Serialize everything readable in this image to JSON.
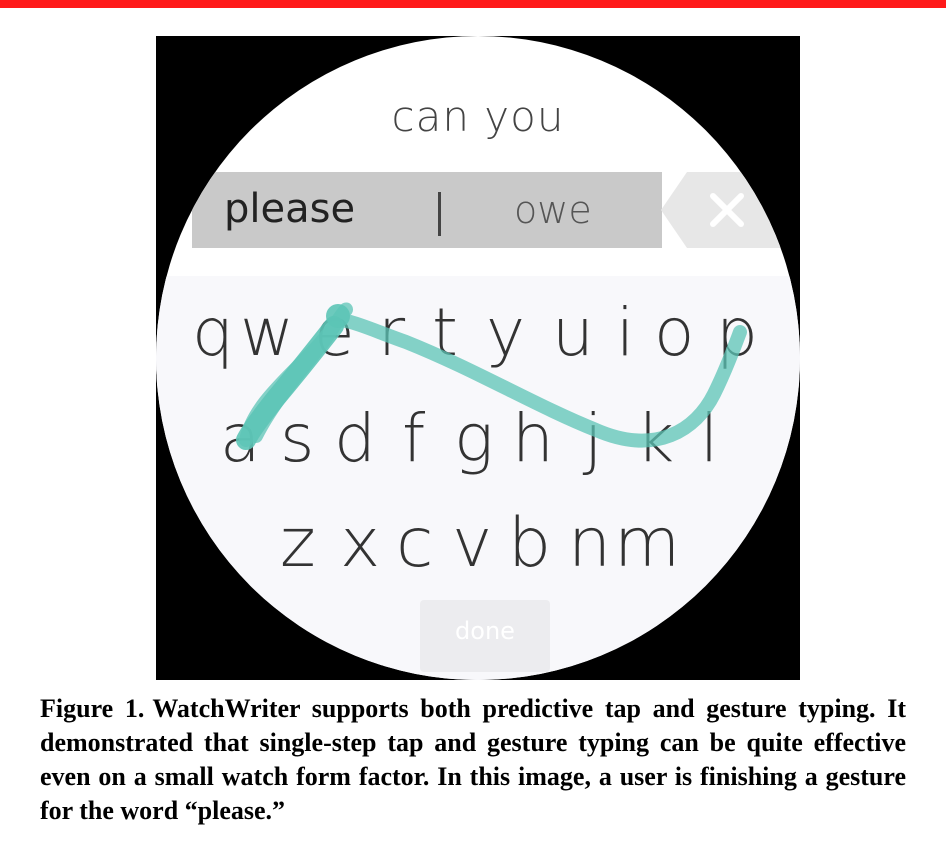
{
  "colors": {
    "top_bar": "#ff1a1a",
    "gesture_trail": "#5cc4b6",
    "suggestion_bar": "#c9c9c9"
  },
  "watch": {
    "composed_text": "can you",
    "suggestions": {
      "primary": "please",
      "divider": "|",
      "secondary": "owe"
    },
    "backspace_icon": "backspace-x-icon",
    "keyboard": {
      "row1": [
        "q",
        "w",
        "e",
        "r",
        "t",
        "y",
        "u",
        "i",
        "o",
        "p"
      ],
      "row2": [
        "a",
        "s",
        "d",
        "f",
        "g",
        "h",
        "j",
        "k",
        "l"
      ],
      "row3": [
        "z",
        "x",
        "c",
        "v",
        "b",
        "n",
        "m"
      ]
    },
    "done_label": "done"
  },
  "caption": {
    "label": "Figure 1.",
    "text": "WatchWriter supports both predictive tap and gesture typing. It demonstrated that single-step tap and gesture typing can be quite effective even on a small watch form factor. In this image, a user is finishing a gesture for the word “please.”"
  }
}
